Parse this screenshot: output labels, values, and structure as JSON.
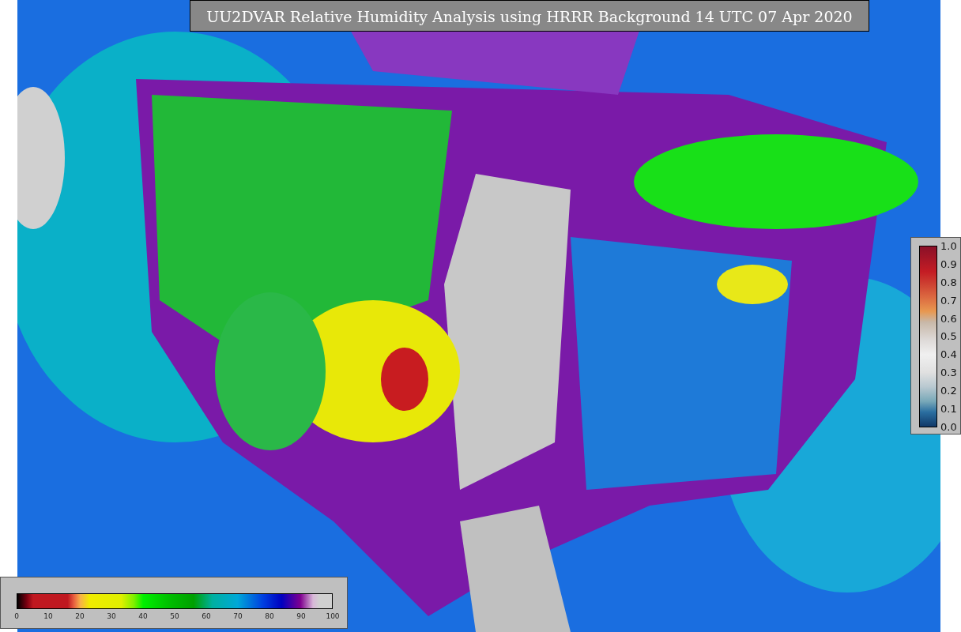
{
  "title": "UU2DVAR Relative Humidity Analysis using HRRR Background 14 UTC 07 Apr 2020",
  "error_colorbar": {
    "ticks": [
      "1.0",
      "0.9",
      "0.8",
      "0.7",
      "0.6",
      "0.5",
      "0.4",
      "0.3",
      "0.2",
      "0.1",
      "0.0"
    ]
  },
  "humidity_colorbar": {
    "ticks": [
      "0",
      "10",
      "20",
      "30",
      "40",
      "50",
      "60",
      "70",
      "80",
      "90",
      "100"
    ]
  }
}
